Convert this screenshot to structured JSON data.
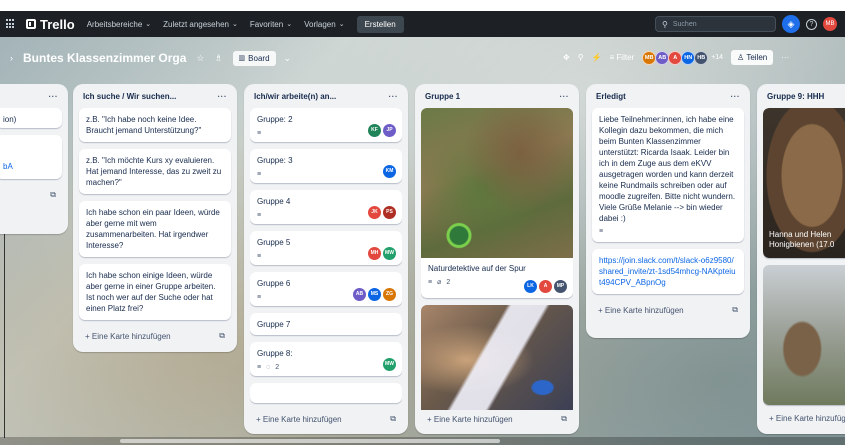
{
  "nav": {
    "logo": "Trello",
    "items": [
      "Arbeitsbereiche",
      "Zuletzt angesehen",
      "Favoriten",
      "Vorlagen"
    ],
    "create": "Erstellen",
    "search_placeholder": "Suchen",
    "user_initials": "MB"
  },
  "board": {
    "title": "Buntes Klassenzimmer Orga",
    "view": "Board",
    "filter": "Filter",
    "members": [
      "MB",
      "AB",
      "A",
      "HN",
      "HB"
    ],
    "member_colors": [
      "#d97706",
      "#6e5dc6",
      "#e2483d",
      "#0c66e4",
      "#44546f"
    ],
    "more_members": "+14",
    "share": "Teilen"
  },
  "lists": {
    "partial": {
      "title": "",
      "card1": "ion)",
      "card2_link": "bA"
    },
    "suche": {
      "title": "Ich suche / Wir suchen...",
      "cards": [
        "z.B. \"Ich habe noch keine Idee. Braucht jemand Unterstützung?\"",
        "z.B. \"Ich möchte Kurs xy evaluieren. Hat jemand Interesse, das zu zweit zu machen?\"",
        "Ich habe schon ein paar Ideen, würde aber gerne mit wem zusammenarbeiten. Hat irgendwer Interesse?",
        "Ich habe schon einige Ideen, würde aber gerne in einer Gruppe arbeiten. Ist noch wer auf der Suche oder hat einen Platz frei?"
      ],
      "add": "Eine Karte hinzufügen"
    },
    "arbeite": {
      "title": "Ich/wir arbeite(n) an...",
      "cards": [
        {
          "title": "Gruppe: 2",
          "members": [
            "KF",
            "JP"
          ],
          "colors": [
            "#1f845a",
            "#6e5dc6"
          ]
        },
        {
          "title": "Gruppe: 3",
          "members": [
            "KM"
          ],
          "colors": [
            "#0c66e4"
          ]
        },
        {
          "title": "Gruppe 4",
          "members": [
            "JK",
            "PS"
          ],
          "colors": [
            "#e2483d",
            "#ae2e24"
          ]
        },
        {
          "title": "Gruppe 5",
          "members": [
            "MH",
            "MW"
          ],
          "colors": [
            "#e2483d",
            "#22a06b"
          ]
        },
        {
          "title": "Gruppe 6",
          "members": [
            "AB",
            "MS",
            "ZG"
          ],
          "colors": [
            "#6e5dc6",
            "#0c66e4",
            "#d97706"
          ]
        },
        {
          "title": "Gruppe 7",
          "members": [],
          "colors": []
        },
        {
          "title": "Gruppe 8:",
          "comments": "2",
          "members": [
            "MW"
          ],
          "colors": [
            "#22a06b"
          ]
        }
      ],
      "add": "Eine Karte hinzufügen"
    },
    "gruppe1": {
      "title": "Gruppe 1",
      "card1_title": "Naturdetektive auf der Spur",
      "card1_attachments": "2",
      "card1_members": [
        "LK",
        "A",
        "MP"
      ],
      "card1_colors": [
        "#0c66e4",
        "#e2483d",
        "#44546f"
      ],
      "add": "Eine Karte hinzufügen"
    },
    "erledigt": {
      "title": "Erledigt",
      "card1": "Liebe Teilnehmer:innen, ich habe eine Kollegin dazu bekommen, die mich beim Bunten Klassenzimmer unterstützt: Ricarda Isaak. Leider bin ich in dem Zuge aus dem eKVV ausgetragen worden und kann derzeit keine Rundmails schreiben oder auf moodle zugreifen. Bitte nicht wundern. Viele Grüße Melanie --> bin wieder dabei :)",
      "card2_link": "https://join.slack.com/t/slack-o6z9580/shared_invite/zt-1sd54mhcg-NAKpteiut494CPV_ABpnOg",
      "add": "Eine Karte hinzufügen"
    },
    "gruppe9": {
      "title": "Gruppe 9: HHH",
      "card1_overlay": "Hanna und Helen\nHonigbienen (17.0",
      "add": "Eine Karte hinzufüg"
    }
  }
}
